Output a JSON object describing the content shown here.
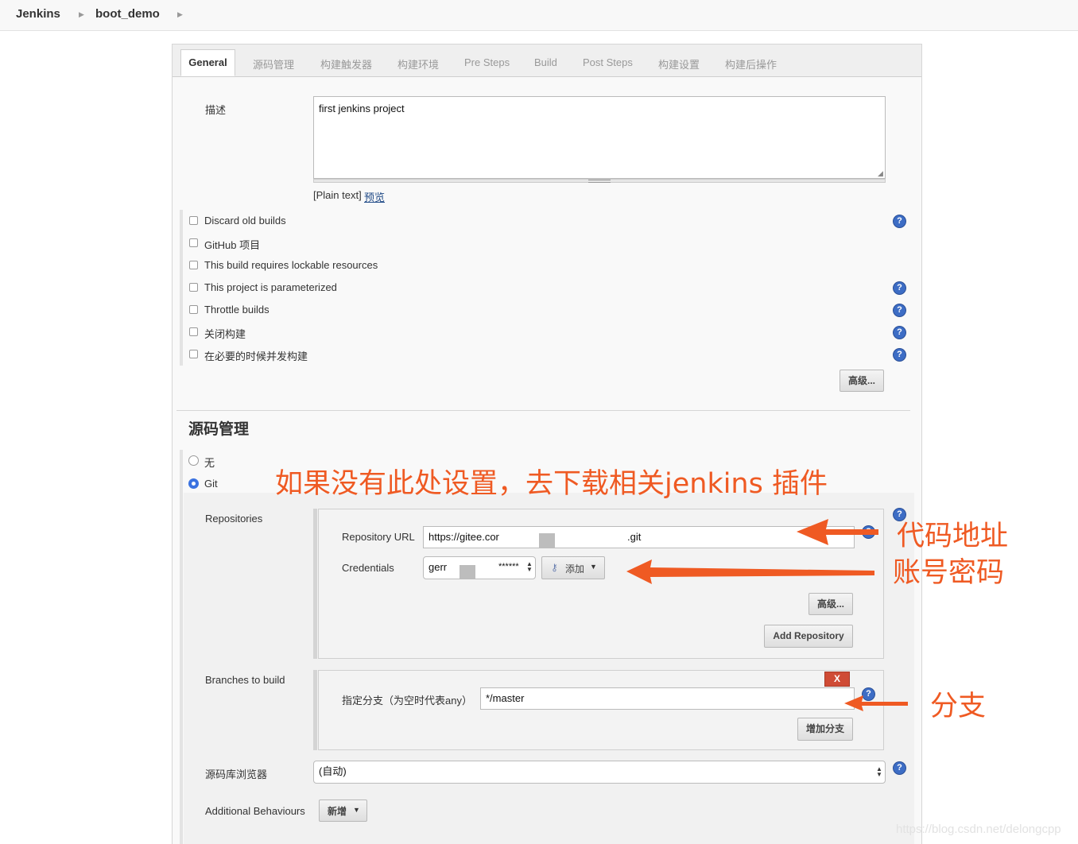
{
  "breadcrumb": {
    "root": "Jenkins",
    "job": "boot_demo"
  },
  "tabs": [
    "General",
    "源码管理",
    "构建触发器",
    "构建环境",
    "Pre Steps",
    "Build",
    "Post Steps",
    "构建设置",
    "构建后操作"
  ],
  "description": {
    "label": "描述",
    "value": "first jenkins project",
    "format": "[Plain text]",
    "preview": "预览"
  },
  "options": [
    "Discard old builds",
    "GitHub 项目",
    "This build requires lockable resources",
    "This project is parameterized",
    "Throttle builds",
    "关闭构建",
    "在必要的时候并发构建"
  ],
  "advanced_label": "高级...",
  "scm": {
    "title": "源码管理",
    "none_label": "无",
    "git_label": "Git",
    "repositories_label": "Repositories",
    "repo_url_label": "Repository URL",
    "repo_url_value": "https://gitee.cor",
    "repo_url_suffix": ".git",
    "credentials_label": "Credentials",
    "credentials_value": "gerr",
    "credentials_mask": "******",
    "add_label": "添加",
    "advanced_label": "高级...",
    "add_repository_label": "Add Repository",
    "branches_label": "Branches to build",
    "delete_label": "X",
    "branch_spec_label": "指定分支（为空时代表any）",
    "branch_spec_value": "*/master",
    "add_branch_label": "增加分支",
    "browser_label": "源码库浏览器",
    "browser_value": "(自动)",
    "behaviours_label": "Additional Behaviours",
    "behaviours_button": "新增"
  },
  "annotations": {
    "plugin_note": "如果没有此处设置，去下载相关jenkins 插件",
    "repo_note": "代码地址",
    "cred_note": "账号密码",
    "branch_note": "分支",
    "accent_color": "#ef5a23"
  },
  "watermark": "https://blog.csdn.net/delongcpp"
}
